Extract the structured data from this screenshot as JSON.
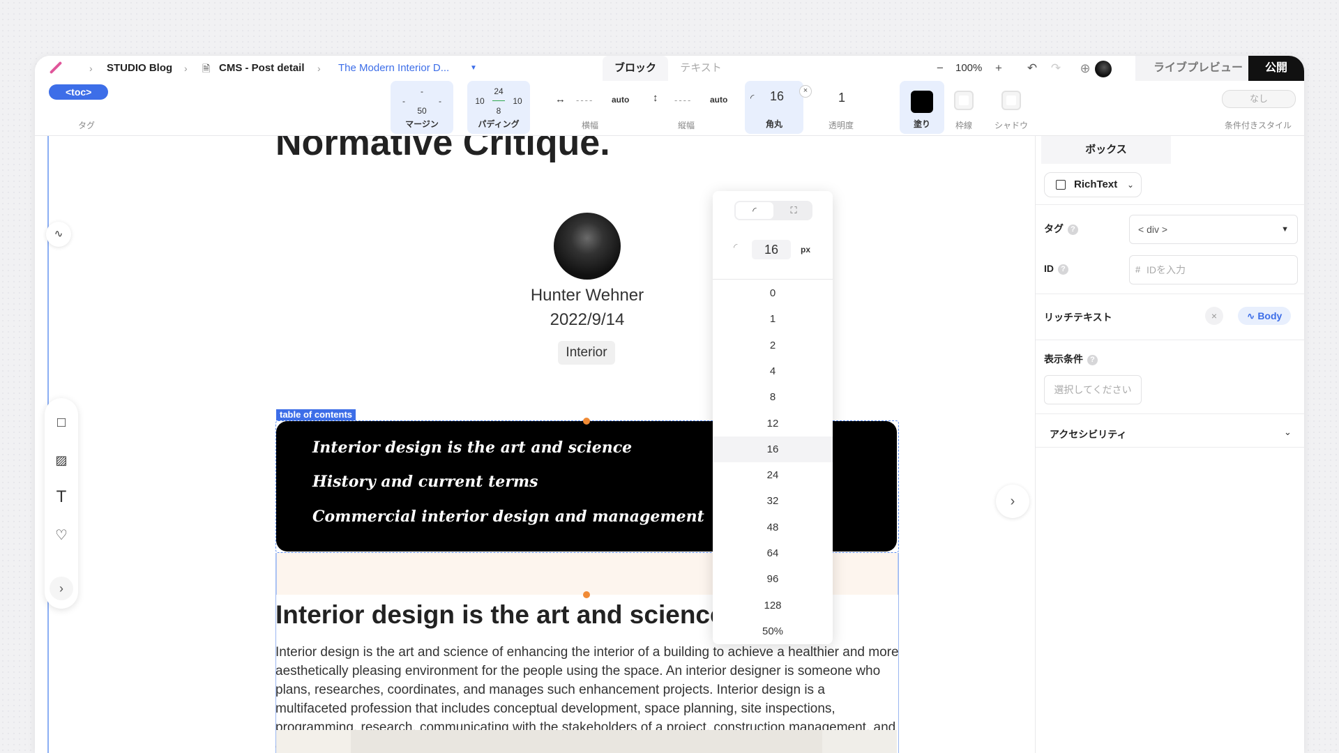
{
  "topbar": {
    "breadcrumb": [
      "STUDIO Blog",
      "CMS - Post detail",
      "The Modern Interior D..."
    ],
    "tabs": [
      "ブロック",
      "テキスト"
    ],
    "zoom": "100%",
    "live_preview": "ライブプレビュー",
    "publish": "公開"
  },
  "toolbar": {
    "tag_chip": "<toc>",
    "tag_label": "タグ",
    "margin": {
      "top": "-",
      "left": "-",
      "right": "-",
      "bottom": "50",
      "label": "マージン"
    },
    "padding": {
      "top": "24",
      "left": "10",
      "right": "10",
      "bottom": "8",
      "label": "パディング"
    },
    "width": {
      "value": "auto",
      "label": "横幅"
    },
    "height": {
      "value": "auto",
      "label": "縦幅"
    },
    "radius": {
      "value": "16",
      "label": "角丸"
    },
    "opacity": {
      "value": "1",
      "label": "透明度"
    },
    "fill_label": "塗り",
    "border_label": "枠線",
    "shadow_label": "シャドウ",
    "conditional": {
      "value": "なし",
      "label": "条件付きスタイル"
    },
    "fill_color": "#000000"
  },
  "canvas": {
    "title_partial": "Normative Critique.",
    "author": "Hunter Wehner",
    "date": "2022/9/14",
    "category": "Interior",
    "toc_label": "table of contents",
    "toc_items": [
      "Interior design is the art and science",
      "History and current terms",
      "Commercial interior design and management"
    ],
    "section_heading": "Interior design is the art and science",
    "section_paragraph": "Interior design is the art and science of enhancing the interior of a building to achieve a healthier and more aesthetically pleasing environment for the people using the space. An interior designer is someone who plans, researches, coordinates, and manages such enhancement projects. Interior design is a multifaceted profession that includes conceptual development, space planning, site inspections, programming, research, communicating with the stakeholders of a project, construction management, and execution of the design."
  },
  "radius_dropdown": {
    "value": "16",
    "unit": "px",
    "options": [
      "0",
      "1",
      "2",
      "4",
      "8",
      "12",
      "16",
      "24",
      "32",
      "48",
      "64",
      "96",
      "128",
      "50%"
    ],
    "selected": "16"
  },
  "right_panel": {
    "tab": "ボックス",
    "component": "RichText",
    "tag_label": "タグ",
    "tag_value": "< div >",
    "id_label": "ID",
    "id_hash": "#",
    "id_placeholder": "IDを入力",
    "richtext_label": "リッチテキスト",
    "richtext_chip": "Body",
    "visibility_label": "表示条件",
    "visibility_placeholder": "選択してください",
    "accessibility_label": "アクセシビリティ"
  },
  "colors": {
    "accent": "#3d6ee8",
    "publish_bg": "#111111",
    "selection": "#5a8cf0",
    "handle": "#f08a35"
  },
  "icons": [
    "logo-slash",
    "doc-icon",
    "caret-down-icon",
    "minus-icon",
    "plus-icon",
    "undo-icon",
    "redo-icon",
    "add-user-icon",
    "path-icon",
    "square-icon",
    "image-icon",
    "text-icon",
    "heart-icon",
    "chevron-right-icon",
    "radius-corner-icon",
    "radius-individual-icon",
    "close-icon",
    "checkbox-icon",
    "help-icon",
    "chevron-down-icon"
  ]
}
